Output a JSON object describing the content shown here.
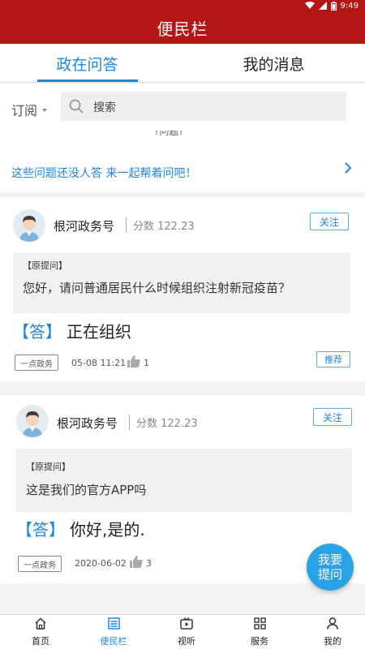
{
  "status": {
    "time": "9:49"
  },
  "app": {
    "title": "便民栏"
  },
  "tabs": [
    {
      "label": "政在问答",
      "active": true
    },
    {
      "label": "我的消息",
      "active": false
    }
  ],
  "search": {
    "subscribe_label": "订阅",
    "placeholder": "搜索"
  },
  "notice": {
    "cutoff_text": "?问题?",
    "text": "这些问题还没人答 来一起帮着问吧！"
  },
  "cards": [
    {
      "user": "根河政务号",
      "score": "分数 122.23",
      "follow": "关注",
      "q_tag": "【原提问】",
      "question": "您好，请问普通居民什么时候组织注射新冠疫苗？",
      "answer_tag": "【答】",
      "answer": "正在组织",
      "source": "一点政务",
      "date": "05-08 11:21",
      "likes": "1",
      "recommend": "推荐"
    },
    {
      "user": "根河政务号",
      "score": "分数 122.23",
      "follow": "关注",
      "q_tag": "【原提问】",
      "question": "这是我们的官方APP吗",
      "answer_tag": "【答】",
      "answer": "你好,是的.",
      "source": "一点政务",
      "date": "2020-06-02",
      "likes": "3"
    }
  ],
  "fab": {
    "line1": "我要",
    "line2": "提问"
  },
  "nav": [
    {
      "label": "首页",
      "icon": "home-icon"
    },
    {
      "label": "便民栏",
      "icon": "grid-list-icon",
      "active": true
    },
    {
      "label": "视听",
      "icon": "tv-play-icon"
    },
    {
      "label": "服务",
      "icon": "apps-icon"
    },
    {
      "label": "我的",
      "icon": "person-icon"
    }
  ],
  "colors": {
    "brand_red": "#b41515",
    "accent_blue": "#1f86d8",
    "fab_blue": "#2aa3e6"
  }
}
